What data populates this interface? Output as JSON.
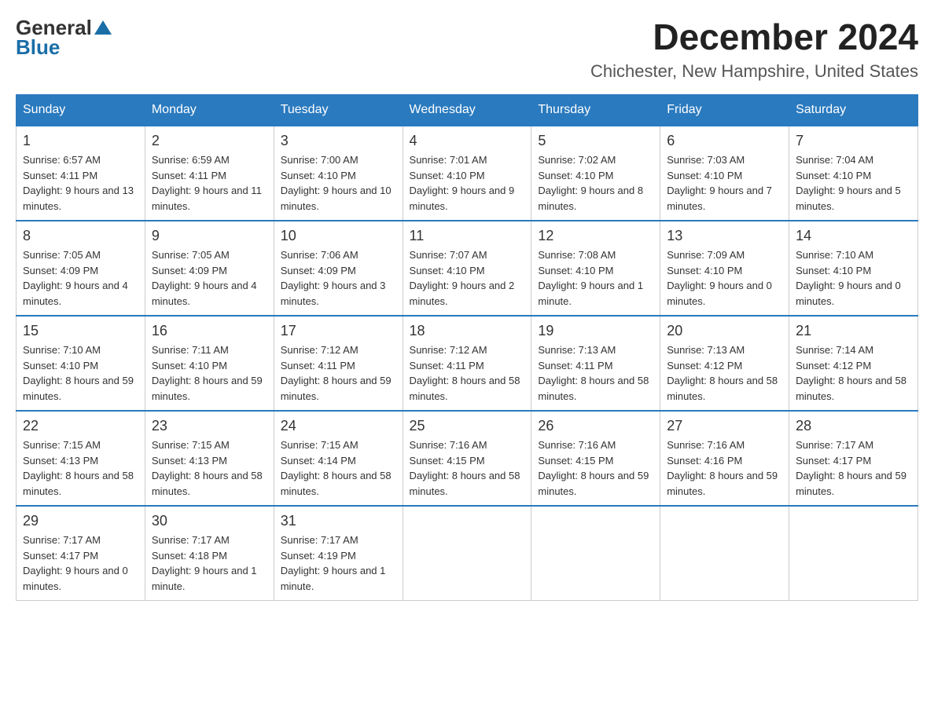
{
  "logo": {
    "general": "General",
    "blue": "Blue"
  },
  "title": {
    "month_year": "December 2024",
    "location": "Chichester, New Hampshire, United States"
  },
  "weekdays": [
    "Sunday",
    "Monday",
    "Tuesday",
    "Wednesday",
    "Thursday",
    "Friday",
    "Saturday"
  ],
  "weeks": [
    [
      {
        "day": "1",
        "sunrise": "Sunrise: 6:57 AM",
        "sunset": "Sunset: 4:11 PM",
        "daylight": "Daylight: 9 hours and 13 minutes."
      },
      {
        "day": "2",
        "sunrise": "Sunrise: 6:59 AM",
        "sunset": "Sunset: 4:11 PM",
        "daylight": "Daylight: 9 hours and 11 minutes."
      },
      {
        "day": "3",
        "sunrise": "Sunrise: 7:00 AM",
        "sunset": "Sunset: 4:10 PM",
        "daylight": "Daylight: 9 hours and 10 minutes."
      },
      {
        "day": "4",
        "sunrise": "Sunrise: 7:01 AM",
        "sunset": "Sunset: 4:10 PM",
        "daylight": "Daylight: 9 hours and 9 minutes."
      },
      {
        "day": "5",
        "sunrise": "Sunrise: 7:02 AM",
        "sunset": "Sunset: 4:10 PM",
        "daylight": "Daylight: 9 hours and 8 minutes."
      },
      {
        "day": "6",
        "sunrise": "Sunrise: 7:03 AM",
        "sunset": "Sunset: 4:10 PM",
        "daylight": "Daylight: 9 hours and 7 minutes."
      },
      {
        "day": "7",
        "sunrise": "Sunrise: 7:04 AM",
        "sunset": "Sunset: 4:10 PM",
        "daylight": "Daylight: 9 hours and 5 minutes."
      }
    ],
    [
      {
        "day": "8",
        "sunrise": "Sunrise: 7:05 AM",
        "sunset": "Sunset: 4:09 PM",
        "daylight": "Daylight: 9 hours and 4 minutes."
      },
      {
        "day": "9",
        "sunrise": "Sunrise: 7:05 AM",
        "sunset": "Sunset: 4:09 PM",
        "daylight": "Daylight: 9 hours and 4 minutes."
      },
      {
        "day": "10",
        "sunrise": "Sunrise: 7:06 AM",
        "sunset": "Sunset: 4:09 PM",
        "daylight": "Daylight: 9 hours and 3 minutes."
      },
      {
        "day": "11",
        "sunrise": "Sunrise: 7:07 AM",
        "sunset": "Sunset: 4:10 PM",
        "daylight": "Daylight: 9 hours and 2 minutes."
      },
      {
        "day": "12",
        "sunrise": "Sunrise: 7:08 AM",
        "sunset": "Sunset: 4:10 PM",
        "daylight": "Daylight: 9 hours and 1 minute."
      },
      {
        "day": "13",
        "sunrise": "Sunrise: 7:09 AM",
        "sunset": "Sunset: 4:10 PM",
        "daylight": "Daylight: 9 hours and 0 minutes."
      },
      {
        "day": "14",
        "sunrise": "Sunrise: 7:10 AM",
        "sunset": "Sunset: 4:10 PM",
        "daylight": "Daylight: 9 hours and 0 minutes."
      }
    ],
    [
      {
        "day": "15",
        "sunrise": "Sunrise: 7:10 AM",
        "sunset": "Sunset: 4:10 PM",
        "daylight": "Daylight: 8 hours and 59 minutes."
      },
      {
        "day": "16",
        "sunrise": "Sunrise: 7:11 AM",
        "sunset": "Sunset: 4:10 PM",
        "daylight": "Daylight: 8 hours and 59 minutes."
      },
      {
        "day": "17",
        "sunrise": "Sunrise: 7:12 AM",
        "sunset": "Sunset: 4:11 PM",
        "daylight": "Daylight: 8 hours and 59 minutes."
      },
      {
        "day": "18",
        "sunrise": "Sunrise: 7:12 AM",
        "sunset": "Sunset: 4:11 PM",
        "daylight": "Daylight: 8 hours and 58 minutes."
      },
      {
        "day": "19",
        "sunrise": "Sunrise: 7:13 AM",
        "sunset": "Sunset: 4:11 PM",
        "daylight": "Daylight: 8 hours and 58 minutes."
      },
      {
        "day": "20",
        "sunrise": "Sunrise: 7:13 AM",
        "sunset": "Sunset: 4:12 PM",
        "daylight": "Daylight: 8 hours and 58 minutes."
      },
      {
        "day": "21",
        "sunrise": "Sunrise: 7:14 AM",
        "sunset": "Sunset: 4:12 PM",
        "daylight": "Daylight: 8 hours and 58 minutes."
      }
    ],
    [
      {
        "day": "22",
        "sunrise": "Sunrise: 7:15 AM",
        "sunset": "Sunset: 4:13 PM",
        "daylight": "Daylight: 8 hours and 58 minutes."
      },
      {
        "day": "23",
        "sunrise": "Sunrise: 7:15 AM",
        "sunset": "Sunset: 4:13 PM",
        "daylight": "Daylight: 8 hours and 58 minutes."
      },
      {
        "day": "24",
        "sunrise": "Sunrise: 7:15 AM",
        "sunset": "Sunset: 4:14 PM",
        "daylight": "Daylight: 8 hours and 58 minutes."
      },
      {
        "day": "25",
        "sunrise": "Sunrise: 7:16 AM",
        "sunset": "Sunset: 4:15 PM",
        "daylight": "Daylight: 8 hours and 58 minutes."
      },
      {
        "day": "26",
        "sunrise": "Sunrise: 7:16 AM",
        "sunset": "Sunset: 4:15 PM",
        "daylight": "Daylight: 8 hours and 59 minutes."
      },
      {
        "day": "27",
        "sunrise": "Sunrise: 7:16 AM",
        "sunset": "Sunset: 4:16 PM",
        "daylight": "Daylight: 8 hours and 59 minutes."
      },
      {
        "day": "28",
        "sunrise": "Sunrise: 7:17 AM",
        "sunset": "Sunset: 4:17 PM",
        "daylight": "Daylight: 8 hours and 59 minutes."
      }
    ],
    [
      {
        "day": "29",
        "sunrise": "Sunrise: 7:17 AM",
        "sunset": "Sunset: 4:17 PM",
        "daylight": "Daylight: 9 hours and 0 minutes."
      },
      {
        "day": "30",
        "sunrise": "Sunrise: 7:17 AM",
        "sunset": "Sunset: 4:18 PM",
        "daylight": "Daylight: 9 hours and 1 minute."
      },
      {
        "day": "31",
        "sunrise": "Sunrise: 7:17 AM",
        "sunset": "Sunset: 4:19 PM",
        "daylight": "Daylight: 9 hours and 1 minute."
      },
      null,
      null,
      null,
      null
    ]
  ]
}
